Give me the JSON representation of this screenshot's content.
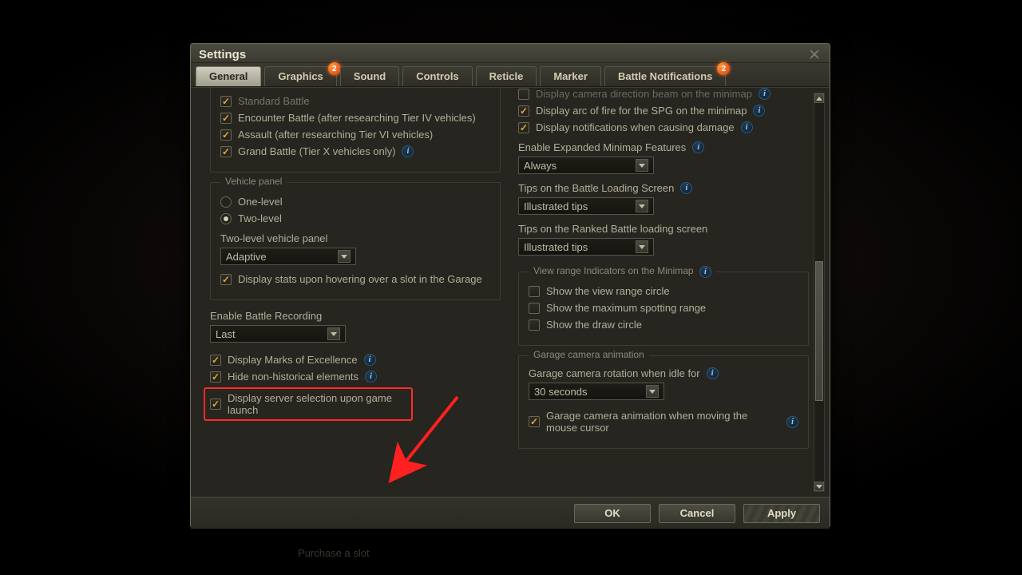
{
  "title": "Settings",
  "tabs": [
    {
      "label": "General",
      "active": true,
      "badge": null
    },
    {
      "label": "Graphics",
      "active": false,
      "badge": "2"
    },
    {
      "label": "Sound",
      "active": false,
      "badge": null
    },
    {
      "label": "Controls",
      "active": false,
      "badge": null
    },
    {
      "label": "Reticle",
      "active": false,
      "badge": null
    },
    {
      "label": "Marker",
      "active": false,
      "badge": null
    },
    {
      "label": "Battle Notifications",
      "active": false,
      "badge": "2"
    }
  ],
  "left": {
    "battle_types": {
      "standard": "Standard Battle",
      "encounter": "Encounter Battle (after researching Tier IV vehicles)",
      "assault": "Assault (after researching Tier VI vehicles)",
      "grand": "Grand Battle (Tier X vehicles only)"
    },
    "vehicle_panel": {
      "legend": "Vehicle panel",
      "one": "One-level",
      "two": "Two-level",
      "two_label": "Two-level vehicle panel",
      "two_select": "Adaptive",
      "hover": "Display stats upon hovering over a slot in the Garage"
    },
    "recording": {
      "label": "Enable Battle Recording",
      "select": "Last"
    },
    "marks": "Display Marks of Excellence",
    "hide": "Hide non-historical elements",
    "server": "Display server selection upon game launch"
  },
  "right": {
    "top_cut_row": "Display camera direction beam on the minimap",
    "arc": "Display arc of fire for the SPG on the minimap",
    "dmg": "Display notifications when causing damage",
    "expand": {
      "label": "Enable Expanded Minimap Features",
      "select": "Always"
    },
    "tips1": {
      "label": "Tips on the Battle Loading Screen",
      "select": "Illustrated tips"
    },
    "tips2": {
      "label": "Tips on the Ranked Battle loading screen",
      "select": "Illustrated tips"
    },
    "view_range": {
      "legend": "View range Indicators on the Minimap",
      "a": "Show the view range circle",
      "b": "Show the maximum spotting range",
      "c": "Show the draw circle"
    },
    "garage": {
      "legend": "Garage camera animation",
      "rot_label": "Garage camera rotation when idle for",
      "rot_select": "30 seconds",
      "mouse": "Garage camera animation when moving the mouse cursor"
    }
  },
  "footer": {
    "ok": "OK",
    "cancel": "Cancel",
    "apply": "Apply"
  },
  "bg_hint": "Purchase a slot"
}
